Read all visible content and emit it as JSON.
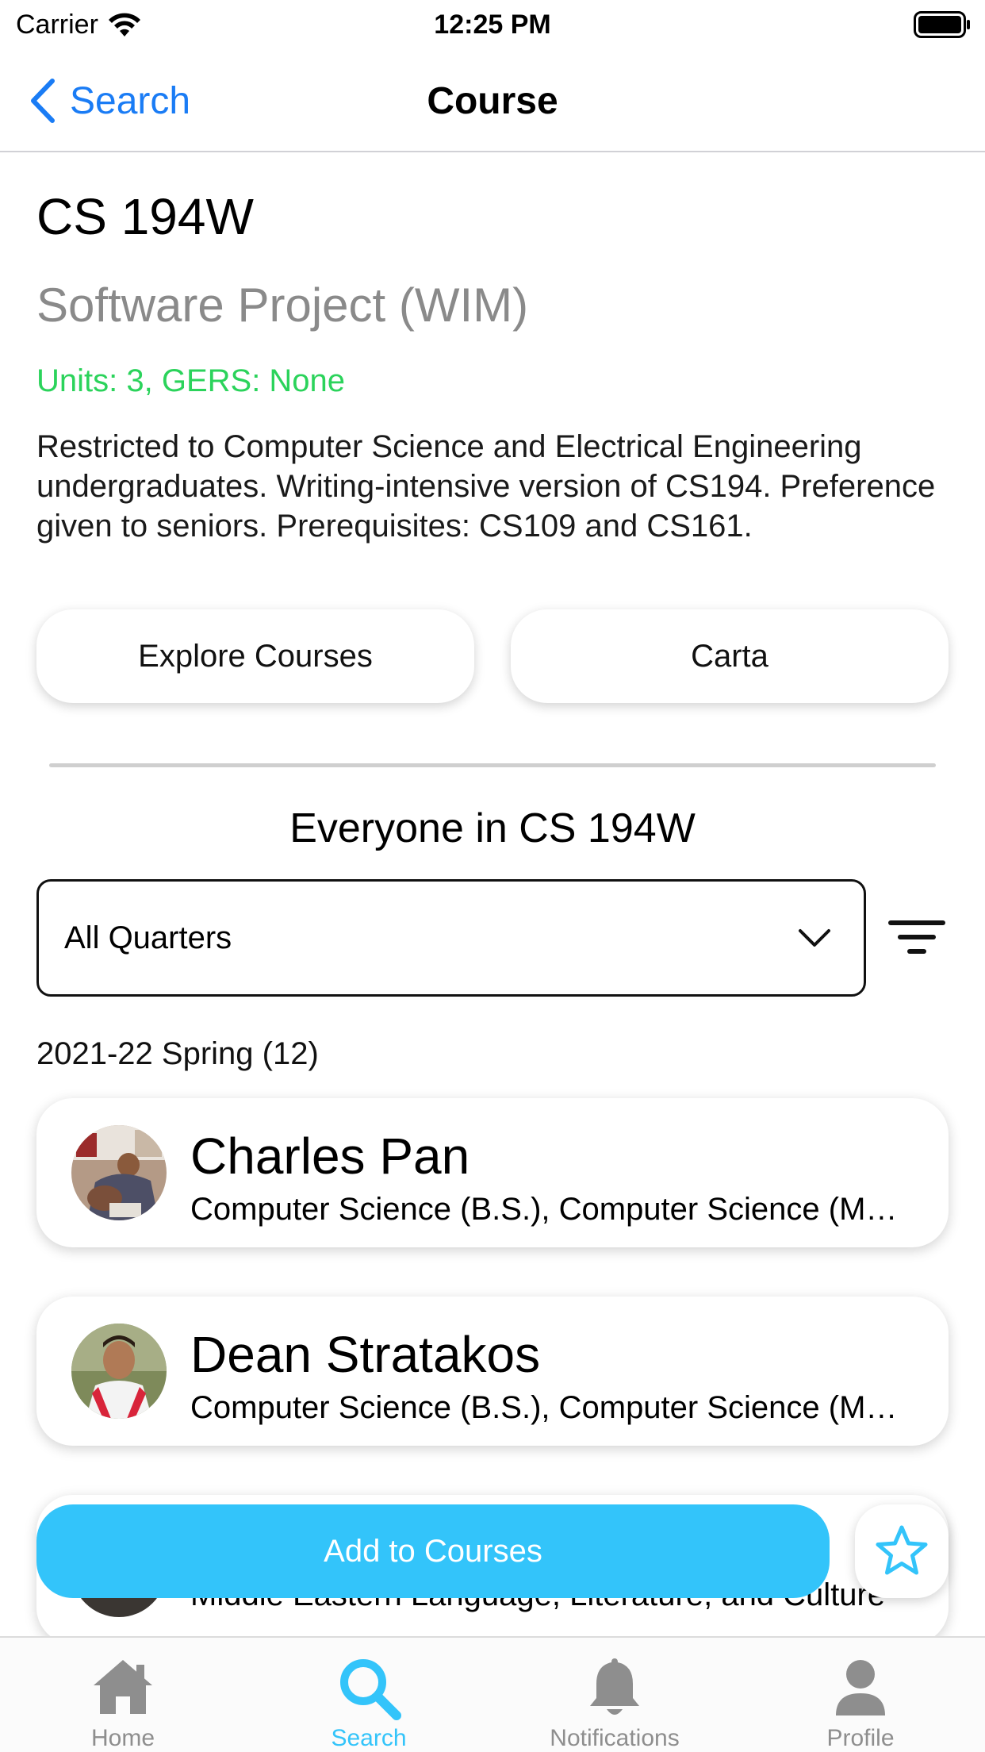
{
  "status_bar": {
    "carrier": "Carrier",
    "time": "12:25 PM"
  },
  "nav": {
    "back_label": "Search",
    "title": "Course"
  },
  "course": {
    "code": "CS 194W",
    "name": "Software Project (WIM)",
    "meta": "Units: 3, GERS: None",
    "description": "Restricted to Computer Science and Electrical Engineering undergraduates.  Writing-intensive version of CS194. Preference given to seniors. Prerequisites: CS109 and CS161."
  },
  "links": {
    "explore": "Explore Courses",
    "carta": "Carta"
  },
  "roster": {
    "title": "Everyone in CS 194W",
    "quarter_select": "All Quarters",
    "quarter_heading": "2021-22 Spring (12)",
    "people": [
      {
        "name": "Charles Pan",
        "major": "Computer Science (B.S.), Computer Science (M.S.)"
      },
      {
        "name": "Dean Stratakos",
        "major": "Computer Science (B.S.), Computer Science (M.S.)"
      },
      {
        "name": "",
        "major": "Middle Eastern Language, Literature, and Culture"
      }
    ]
  },
  "actions": {
    "add_label": "Add to Courses"
  },
  "tabs": [
    {
      "label": "Home",
      "icon": "home-icon"
    },
    {
      "label": "Search",
      "icon": "search-icon"
    },
    {
      "label": "Notifications",
      "icon": "bell-icon"
    },
    {
      "label": "Profile",
      "icon": "profile-icon"
    }
  ],
  "colors": {
    "accent_blue": "#1a7cf5",
    "primary_cyan": "#33c4fa",
    "units_green": "#2bd35b",
    "muted_gray": "#8a8a8a"
  }
}
